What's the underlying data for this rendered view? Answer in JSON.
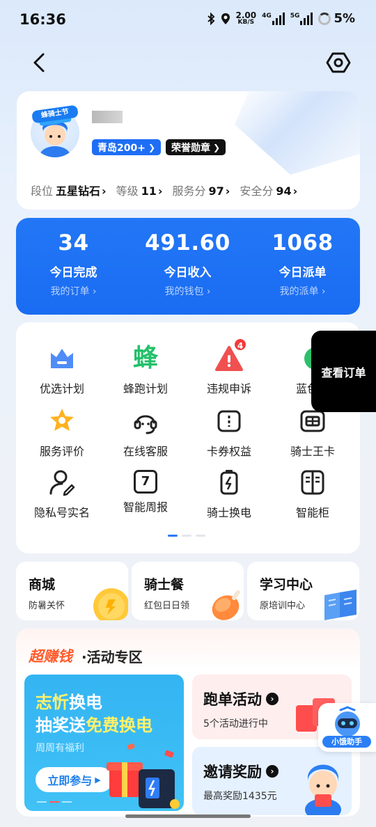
{
  "status_bar": {
    "time": "16:36",
    "speed_value": "2.00",
    "speed_unit": "KB/S",
    "net1": "4G",
    "net2": "5G",
    "battery": "5%"
  },
  "nav": {
    "back_icon": "chevron-left-icon",
    "settings_icon": "hexagon-settings-icon"
  },
  "profile": {
    "avatar_badge": "蜂骑士节",
    "city_chip": "青岛200+",
    "medal_chip": "荣誉勋章",
    "stats": [
      {
        "label": "段位",
        "value": "五星钻石"
      },
      {
        "label": "等级",
        "value": "11"
      },
      {
        "label": "服务分",
        "value": "97"
      },
      {
        "label": "安全分",
        "value": "94"
      }
    ]
  },
  "summary": [
    {
      "value": "34",
      "label": "今日完成",
      "link": "我的订单"
    },
    {
      "value": "491.60",
      "label": "今日收入",
      "link": "我的钱包"
    },
    {
      "value": "1068",
      "label": "今日派单",
      "link": "我的派单"
    }
  ],
  "grid": {
    "items": [
      {
        "label": "优选计划",
        "icon": "crown-icon"
      },
      {
        "label": "蜂跑计划",
        "icon": "bee-run-icon",
        "glyph": "蜂"
      },
      {
        "label": "违规申诉",
        "icon": "warning-triangle-icon",
        "badge": "4"
      },
      {
        "label": "蓝色风",
        "icon": "blue-wind-icon"
      },
      {
        "label": "服务评价",
        "icon": "star-badge-icon"
      },
      {
        "label": "在线客服",
        "icon": "headset-icon"
      },
      {
        "label": "卡券权益",
        "icon": "ticket-icon"
      },
      {
        "label": "骑士王卡",
        "icon": "card-icon"
      },
      {
        "label": "隐私号实名",
        "icon": "user-edit-icon"
      },
      {
        "label": "智能周报",
        "icon": "calendar-icon",
        "glyph": "7"
      },
      {
        "label": "骑士换电",
        "icon": "battery-swap-icon"
      },
      {
        "label": "智能柜",
        "icon": "cabinet-icon"
      }
    ]
  },
  "floating_view_orders": "查看订单",
  "mini_cards": [
    {
      "title": "商城",
      "sub": "防暑关怀"
    },
    {
      "title": "骑士餐",
      "sub": "红包日日领"
    },
    {
      "title": "学习中心",
      "sub": "原培训中心"
    }
  ],
  "activity": {
    "title_highlight": "超赚钱",
    "title_rest": "·活动专区",
    "promo": {
      "line1_a": "志忻",
      "line1_b": "换电",
      "line2_a": "抽奖送",
      "line2_b": "免费换电",
      "sub": "周周有福利",
      "button": "立即参与"
    },
    "run": {
      "title": "跑单活动",
      "sub": "5个活动进行中"
    },
    "invite": {
      "title": "邀请奖励",
      "sub": "最高奖励1435元"
    }
  },
  "assistant": {
    "label": "小饿助手"
  },
  "colors": {
    "primary_blue": "#1e6ef5",
    "orange": "#ff5a2a",
    "alert_red": "#f23b3b",
    "bee_green": "#22c06a"
  }
}
